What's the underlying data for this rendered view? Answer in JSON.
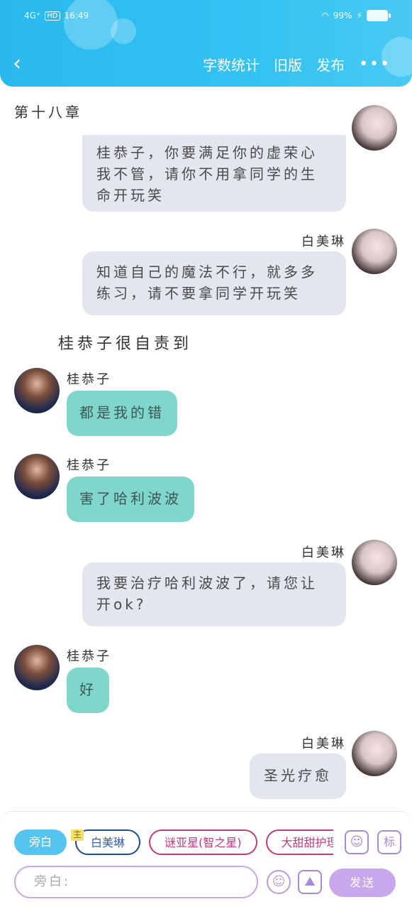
{
  "status_bar": {
    "network": "4G⁺",
    "hd": "HD",
    "time": "16:49",
    "battery_text": "99%"
  },
  "header": {
    "back_icon": "chevron-left-icon",
    "word_count": "字数统计",
    "old_version": "旧版",
    "publish": "发布",
    "more": "•••"
  },
  "chapter": "第十八章",
  "messages": [
    {
      "side": "right",
      "text": "桂恭子，你要满足你的虚荣心我不管，请你不用拿同学的生命开玩笑"
    },
    {
      "side": "right",
      "name": "白美琳",
      "text": "知道自己的魔法不行，就多多练习，请不要拿同学开玩笑"
    },
    {
      "side": "narration",
      "text": "桂恭子很自责到"
    },
    {
      "side": "left",
      "name": "桂恭子",
      "text": "都是我的错"
    },
    {
      "side": "left",
      "name": "桂恭子",
      "text": "害了哈利波波"
    },
    {
      "side": "right",
      "name": "白美琳",
      "text": "我要治疗哈利波波了，请您让开ok?"
    },
    {
      "side": "left",
      "name": "桂恭子",
      "text": "好"
    },
    {
      "side": "right",
      "name": "白美琳",
      "text": "圣光疗愈"
    }
  ],
  "composer": {
    "chips": [
      {
        "label": "旁白",
        "style": "active"
      },
      {
        "label": "白美琳",
        "style": "blue",
        "tag": "主"
      },
      {
        "label": "谜亚星(智之星)",
        "style": "pink"
      },
      {
        "label": "大甜甜护理长",
        "style": "pink"
      }
    ],
    "input_placeholder": "旁白:",
    "send": "发送",
    "label_button": "标"
  },
  "colors": {
    "header": "#33c2f2",
    "bubble_gray": "#e3e6ee",
    "bubble_teal": "#7fd6cb",
    "accent_purple": "#c9a7ec"
  }
}
